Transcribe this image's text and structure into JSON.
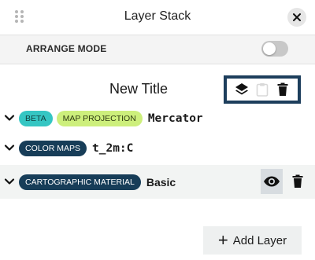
{
  "header": {
    "title": "Layer Stack",
    "close_icon": "close-icon",
    "drag_icon": "drag-handle-icon"
  },
  "arrange": {
    "label": "ARRANGE MODE",
    "enabled": false
  },
  "group": {
    "title": "New Title",
    "actions": [
      "layers-icon",
      "clipboard-icon",
      "trash-icon"
    ],
    "highlight_color": "#1d3e5c"
  },
  "layers": [
    {
      "chips": [
        "BETA",
        "MAP PROJECTION"
      ],
      "name": "Mercator",
      "expanded": false
    },
    {
      "chips": [
        "COLOR MAPS"
      ],
      "name": "t_2m:C",
      "expanded": false
    },
    {
      "chips": [
        "CARTOGRAPHIC MATERIAL"
      ],
      "name": "Basic",
      "expanded": false,
      "visible": true
    }
  ],
  "footer": {
    "add_label": "Add Layer"
  },
  "colors": {
    "teal_chip": "#35c6c3",
    "lime_chip": "#cdef7c",
    "navy_chip": "#173d58"
  }
}
